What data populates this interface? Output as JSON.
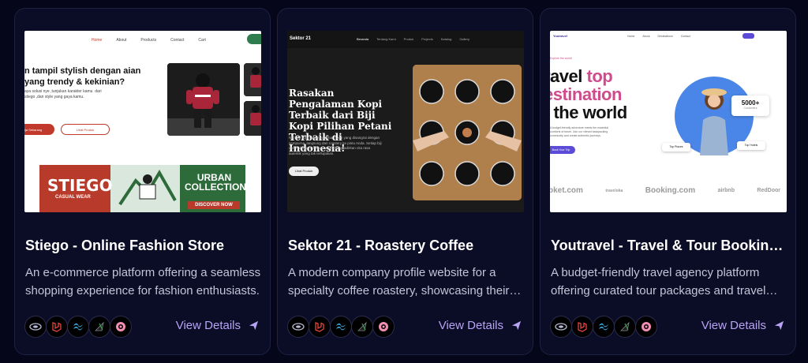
{
  "cards": [
    {
      "title": "Stiego - Online Fashion Store",
      "description": "An e-commerce platform offering a seamless shopping experience for fashion enthusiasts.",
      "view_label": "View Details",
      "preview": {
        "nav": [
          "Home",
          "About",
          "Products",
          "Contact",
          "Cart"
        ],
        "headline": "n tampil stylish dengan aian yang trendy & kekinian?",
        "text": "aya solusi nye ,tunjukan karakter kamu  dari stiego ,dan style yang gaya kamu.",
        "primary_btn": "lja Sekarang",
        "secondary_btn": "Lihat Produk",
        "banner_brand": "STIEGO",
        "banner_sub": "CASUAL WEAR",
        "banner_collection": "URBAN COLLECTION",
        "banner_cta": "DISCOVER NOW"
      }
    },
    {
      "title": "Sektor 21 - Roastery Coffee",
      "description": "A modern company profile website for a specialty coffee roastery, showcasing their products and services.",
      "view_label": "View Details",
      "preview": {
        "logo": "Sektor 21",
        "nav": [
          "Beranda",
          "Tentang Kami",
          "Produk",
          "Projects",
          "Katalog",
          "Gallery"
        ],
        "headline": "Rasakan Pengalaman Kopi Terbaik dari Biji Kopi Pilihan Petani Terbaik di Indonesia!",
        "text": "Nikmati kopi specialty pilihan kami yang disangrai dengan sempurna, langsung dari roastery ke pintu Anda. Setiap biji dipilih dengan cermat untuk menghadirkan cita rasa autentik yang tak terlupakan.",
        "button": "Lihat Produk"
      }
    },
    {
      "title": "Youtravel - Travel & Tour Booking Website",
      "description": "A budget-friendly travel agency platform offering curated tour packages and travel experiences.",
      "view_label": "View Details",
      "preview": {
        "logo": "Youtravel",
        "nav": [
          "Home",
          "About",
          "Destinations",
          "Contact"
        ],
        "tag": "Explore the world!",
        "headline_1": "ravel ",
        "headline_2": "top",
        "headline_3": "estination",
        "headline_4": "f the world",
        "text": "A budget-friendly adventure meets the essential comforts of travel. Join our vibrant backpacking community and create authentic journeys.",
        "button": "Book Your Trip",
        "stat": "5000+",
        "stat_label": "Customers",
        "chip_1": "Top Places",
        "chip_2": "Top Hotels",
        "partners": [
          "bket.com",
          "traveloka",
          "Booking.com",
          "airbnb",
          "RedDoor"
        ]
      }
    }
  ],
  "tech_icons": [
    "nextjs-icon",
    "laravel-icon",
    "tailwind-icon",
    "mongodb-icon",
    "gatsby-icon"
  ],
  "colors": {
    "background": "#05061a",
    "card": "#0b0c26",
    "accent": "#b8a4f5",
    "text_muted": "#c3c4d8"
  }
}
